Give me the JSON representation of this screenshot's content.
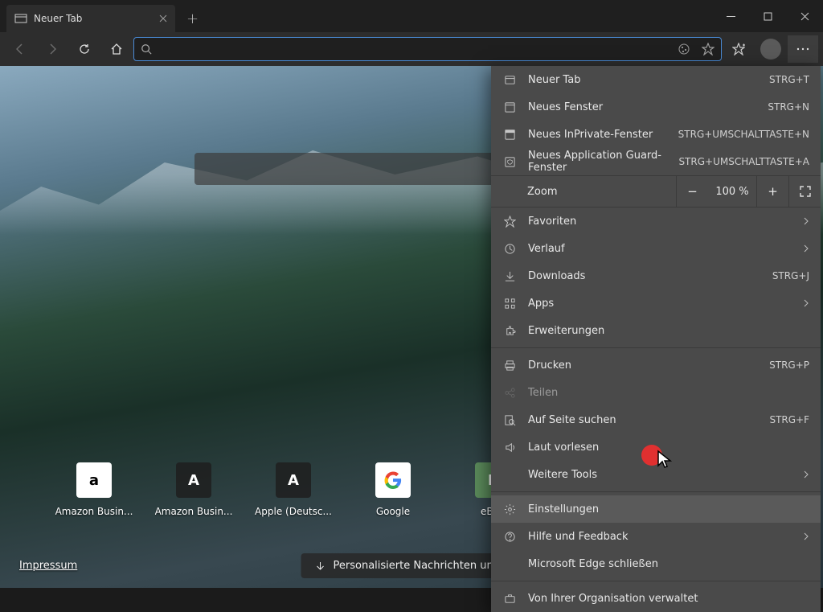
{
  "tab": {
    "title": "Neuer Tab"
  },
  "tiles": [
    {
      "label": "Amazon Busin...",
      "letter": "a",
      "style": "white"
    },
    {
      "label": "Amazon Busin...",
      "letter": "A",
      "style": "dark"
    },
    {
      "label": "Apple (Deutsc...",
      "letter": "A",
      "style": "dark"
    },
    {
      "label": "Google",
      "letter": "G",
      "style": "g"
    },
    {
      "label": "eBay",
      "letter": "E",
      "style": "e"
    }
  ],
  "footer": {
    "imprint": "Impressum",
    "news": "Personalisierte Nachrichten und r"
  },
  "menu": {
    "new_tab": "Neuer Tab",
    "new_tab_sc": "STRG+T",
    "new_window": "Neues Fenster",
    "new_window_sc": "STRG+N",
    "inprivate": "Neues InPrivate-Fenster",
    "inprivate_sc": "STRG+UMSCHALTTASTE+N",
    "appguard": "Neues Application Guard-Fenster",
    "appguard_sc": "STRG+UMSCHALTTASTE+A",
    "zoom": "Zoom",
    "zoom_val": "100 %",
    "favorites": "Favoriten",
    "history": "Verlauf",
    "downloads": "Downloads",
    "downloads_sc": "STRG+J",
    "apps": "Apps",
    "extensions": "Erweiterungen",
    "print": "Drucken",
    "print_sc": "STRG+P",
    "share": "Teilen",
    "find": "Auf Seite suchen",
    "find_sc": "STRG+F",
    "read_aloud": "Laut vorlesen",
    "more_tools": "Weitere Tools",
    "settings": "Einstellungen",
    "help": "Hilfe und Feedback",
    "close": "Microsoft Edge schließen",
    "managed": "Von Ihrer Organisation verwaltet"
  }
}
